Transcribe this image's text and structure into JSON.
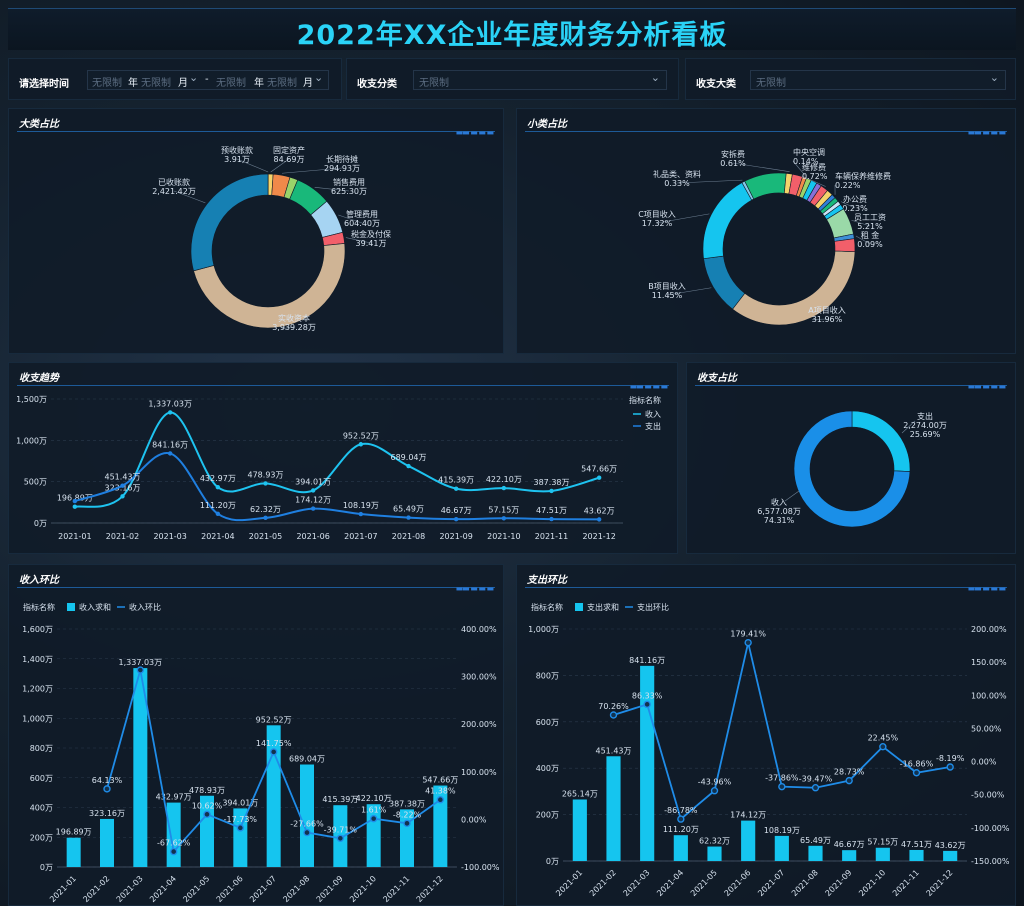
{
  "title": "2022年XX企业年度财务分析看板",
  "filters": {
    "time_label": "请选择时间",
    "placeholder": "无限制",
    "year_unit": "年",
    "month_unit": "月",
    "dash": "-",
    "category_label": "收支分类",
    "major_label": "收支大类"
  },
  "panels": {
    "major": "大类占比",
    "minor": "小类占比",
    "trend": "收支趋势",
    "ratio": "收支占比",
    "income_mom": "收入环比",
    "expense_mom": "支出环比"
  },
  "chart_data": [
    {
      "id": "major",
      "type": "pie",
      "title": "大类占比",
      "slices": [
        {
          "name": "预收账款",
          "label": "3.91万",
          "value": 3.91,
          "color": "#3d8fd6"
        },
        {
          "name": "固定资产",
          "label": "84.69万",
          "value": 84.69,
          "color": "#f5d36b"
        },
        {
          "name": "长期待摊",
          "label": "294.93万",
          "value": 294.93,
          "color": "#f0894a"
        },
        {
          "name": "",
          "label": "",
          "value": 140,
          "color": "#9ad36a"
        },
        {
          "name": "销售费用",
          "label": "625.30万",
          "value": 625.3,
          "color": "#19b87a"
        },
        {
          "name": "管理费用",
          "label": "604.40万",
          "value": 604.4,
          "color": "#a6d4f2"
        },
        {
          "name": "税金及付保",
          "label": "39.41万",
          "value": 194.1,
          "color": "#f25f6a"
        },
        {
          "name": "实收资本",
          "label": "3,939.28万",
          "value": 3939.28,
          "color": "#cfb495"
        },
        {
          "name": "已收账款",
          "label": "2,421.42万",
          "value": 2421.42,
          "color": "#1680b3"
        }
      ]
    },
    {
      "id": "minor",
      "type": "pie",
      "title": "小类占比",
      "slices": [
        {
          "name": "A项目收入",
          "label": "31.96%",
          "value": 31.96,
          "color": "#cfb495"
        },
        {
          "name": "B项目收入",
          "label": "11.45%",
          "value": 11.45,
          "color": "#1680b3"
        },
        {
          "name": "C项目收入",
          "label": "17.32%",
          "value": 17.32,
          "color": "#15c5ef"
        },
        {
          "name": "礼品类、资料",
          "label": "0.33%",
          "value": 0.6,
          "color": "#86c7e8"
        },
        {
          "name": "",
          "label": "",
          "value": 8.2,
          "color": "#19b87a"
        },
        {
          "name": "安拆费",
          "label": "0.61%",
          "value": 1.2,
          "color": "#f5d36b"
        },
        {
          "name": "",
          "label": "",
          "value": 2.0,
          "color": "#f25f6a"
        },
        {
          "name": "中央空调",
          "label": "0.14%",
          "value": 0.8,
          "color": "#f0894a"
        },
        {
          "name": "",
          "label": "",
          "value": 1.0,
          "color": "#9ad36a"
        },
        {
          "name": "",
          "label": "",
          "value": 1.2,
          "color": "#15c5ef"
        },
        {
          "name": "",
          "label": "",
          "value": 1.0,
          "color": "#8a6fd6"
        },
        {
          "name": "维修费",
          "label": "0.72%",
          "value": 1.5,
          "color": "#f25f6a"
        },
        {
          "name": "",
          "label": "",
          "value": 1.2,
          "color": "#f5d36b"
        },
        {
          "name": "车辆保养维修费",
          "label": "0.22%",
          "value": 0.8,
          "color": "#2f7fd6"
        },
        {
          "name": "",
          "label": "",
          "value": 0.9,
          "color": "#19b87a"
        },
        {
          "name": "办公费",
          "label": "0.23%",
          "value": 0.8,
          "color": "#c9e3f5"
        },
        {
          "name": "",
          "label": "",
          "value": 1.0,
          "color": "#15c5ef"
        },
        {
          "name": "员工工资",
          "label": "5.21%",
          "value": 5.21,
          "color": "#9ad9a8"
        },
        {
          "name": "租 金",
          "label": "0.09%",
          "value": 0.9,
          "color": "#3d8fd6"
        },
        {
          "name": "",
          "label": "",
          "value": 2.5,
          "color": "#f25f6a"
        }
      ]
    },
    {
      "id": "trend",
      "type": "line",
      "title": "收支趋势",
      "legend_title": "指标名称",
      "categories": [
        "2021-01",
        "2021-02",
        "2021-03",
        "2021-04",
        "2021-05",
        "2021-06",
        "2021-07",
        "2021-08",
        "2021-09",
        "2021-10",
        "2021-11",
        "2021-12"
      ],
      "yticks": [
        "0万",
        "500万",
        "1,000万",
        "1,500万"
      ],
      "ylim": [
        0,
        1500
      ],
      "series": [
        {
          "name": "收入",
          "color": "#1ec3f0",
          "values": [
            196.89,
            323.16,
            1337.03,
            432.97,
            478.93,
            394.01,
            952.52,
            689.04,
            415.39,
            422.1,
            387.38,
            547.66
          ],
          "labels": [
            "196.89万",
            "323.16万",
            "1,337.03万",
            "432.97万",
            "478.93万",
            "394.01万",
            "952.52万",
            "689.04万",
            "415.39万",
            "422.10万",
            "387.38万",
            "547.66万"
          ]
        },
        {
          "name": "支出",
          "color": "#1f7fe0",
          "values": [
            265.14,
            451.43,
            841.16,
            111.2,
            62.32,
            174.12,
            108.19,
            65.49,
            46.67,
            57.15,
            47.51,
            43.62
          ],
          "labels": [
            "",
            "451.43万",
            "841.16万",
            "111.20万",
            "62.32万",
            "174.12万",
            "108.19万",
            "65.49万",
            "46.67万",
            "57.15万",
            "47.51万",
            "43.62万"
          ]
        }
      ]
    },
    {
      "id": "ratio",
      "type": "pie",
      "title": "收支占比",
      "slices": [
        {
          "name": "支出",
          "label": "2,274.00万",
          "pct": "25.69%",
          "value": 2274.0,
          "color": "#15c5ef"
        },
        {
          "name": "收入",
          "label": "6,577.08万",
          "pct": "74.31%",
          "value": 6577.08,
          "color": "#1a8fe8"
        }
      ]
    },
    {
      "id": "income_mom",
      "type": "bar",
      "title": "收入环比",
      "legend_title": "指标名称",
      "bar_name": "收入求和",
      "line_name": "收入环比",
      "categories": [
        "2021-01",
        "2021-02",
        "2021-03",
        "2021-04",
        "2021-05",
        "2021-06",
        "2021-07",
        "2021-08",
        "2021-09",
        "2021-10",
        "2021-11",
        "2021-12"
      ],
      "values": [
        196.89,
        323.16,
        1337.03,
        432.97,
        478.93,
        394.01,
        952.52,
        689.04,
        415.39,
        422.1,
        387.38,
        547.66
      ],
      "value_labels": [
        "196.89万",
        "323.16万",
        "1,337.03万",
        "432.97万",
        "478.93万",
        "394.01万",
        "952.52万",
        "689.04万",
        "415.39万",
        "422.10万",
        "387.38万",
        "547.66万"
      ],
      "ylim": [
        0,
        1600
      ],
      "yticks": [
        "0万",
        "200万",
        "400万",
        "600万",
        "800万",
        "1,000万",
        "1,200万",
        "1,400万",
        "1,600万"
      ],
      "ratio": [
        null,
        64.13,
        313.74,
        -67.62,
        10.62,
        -17.73,
        141.75,
        -27.66,
        -39.71,
        1.61,
        -8.22,
        41.38
      ],
      "ratio_labels": [
        "",
        "64.13%",
        "",
        "-67.62%",
        "10.62%",
        "-17.73%",
        "141.75%",
        "-27.66%",
        "-39.71%",
        "1.61%",
        "-8.22%",
        "41.38%"
      ],
      "ratio_ylim": [
        -100,
        400
      ],
      "ratio_ticks": [
        "-100.00%",
        "0.00%",
        "100.00%",
        "200.00%",
        "300.00%",
        "400.00%"
      ]
    },
    {
      "id": "expense_mom",
      "type": "bar",
      "title": "支出环比",
      "legend_title": "指标名称",
      "bar_name": "支出求和",
      "line_name": "支出环比",
      "categories": [
        "2021-01",
        "2021-02",
        "2021-03",
        "2021-04",
        "2021-05",
        "2021-06",
        "2021-07",
        "2021-08",
        "2021-09",
        "2021-10",
        "2021-11",
        "2021-12"
      ],
      "values": [
        265.14,
        451.43,
        841.16,
        111.2,
        62.32,
        174.12,
        108.19,
        65.49,
        46.67,
        57.15,
        47.51,
        43.62
      ],
      "value_labels": [
        "265.14万",
        "451.43万",
        "841.16万",
        "111.20万",
        "62.32万",
        "174.12万",
        "108.19万",
        "65.49万",
        "46.67万",
        "57.15万",
        "47.51万",
        "43.62万"
      ],
      "ylim": [
        0,
        1000
      ],
      "yticks": [
        "0万",
        "200万",
        "400万",
        "600万",
        "800万",
        "1,000万"
      ],
      "ratio": [
        null,
        70.26,
        86.33,
        -86.78,
        -43.96,
        179.41,
        -37.86,
        -39.47,
        -28.73,
        22.45,
        -16.86,
        -8.19
      ],
      "ratio_labels": [
        "",
        "70.26%",
        "86.33%",
        "-86.78%",
        "-43.96%",
        "179.41%",
        "-37.86%",
        "-39.47%",
        "28.73%",
        "22.45%",
        "-16.86%",
        "-8.19%"
      ],
      "ratio_ylim": [
        -150,
        200
      ],
      "ratio_ticks": [
        "-150.00%",
        "-100.00%",
        "-50.00%",
        "0.00%",
        "50.00%",
        "100.00%",
        "150.00%",
        "200.00%"
      ]
    }
  ]
}
